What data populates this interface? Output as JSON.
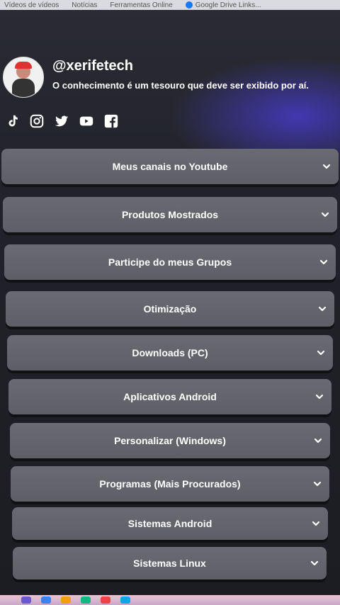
{
  "bookmarks": [
    {
      "label": "Vídeos de vídeos"
    },
    {
      "label": "Notícias"
    },
    {
      "label": "Ferramentas Online"
    },
    {
      "label": "Google Drive Links..."
    }
  ],
  "profile": {
    "handle": "@xerifetech",
    "bio": "O conhecimento é um tesouro que deve ser exibido por aí."
  },
  "socials": [
    {
      "icon": "tiktok-icon"
    },
    {
      "icon": "instagram-icon"
    },
    {
      "icon": "twitter-icon"
    },
    {
      "icon": "youtube-icon"
    },
    {
      "icon": "facebook-icon"
    }
  ],
  "links": [
    {
      "label": "Meus canais no Youtube"
    },
    {
      "label": "Produtos Mostrados"
    },
    {
      "label": "Participe do meus Grupos"
    },
    {
      "label": "Otimização"
    },
    {
      "label": "Downloads (PC)"
    },
    {
      "label": "Aplicativos Android"
    },
    {
      "label": "Personalizar (Windows)"
    },
    {
      "label": "Programas (Mais Procurados)"
    },
    {
      "label": "Sistemas Android"
    },
    {
      "label": "Sistemas Linux"
    }
  ],
  "colors": {
    "accent_glow": "#463cc8",
    "button_bg": "#64656c",
    "text": "#ffffff"
  }
}
